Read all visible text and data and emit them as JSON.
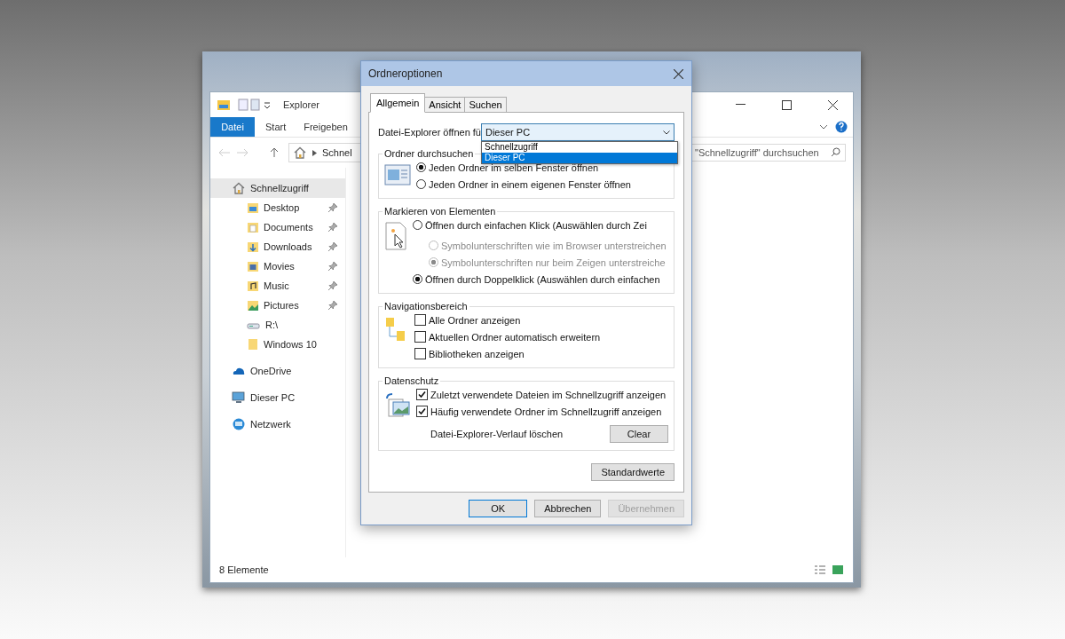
{
  "explorer": {
    "title": "Explorer",
    "ribbon_tabs": [
      {
        "label": "Datei",
        "selected": true
      },
      {
        "label": "Start",
        "selected": false
      },
      {
        "label": "Freigeben",
        "selected": false
      }
    ],
    "address": "Schnel",
    "search": {
      "placeholder": "\"Schnellzugriff\" durchsuchen"
    },
    "nav": [
      {
        "label": "Schnellzugriff",
        "kind": "home",
        "selected": true,
        "children": [
          {
            "label": "Desktop",
            "kind": "desktop",
            "pinned": true
          },
          {
            "label": "Documents",
            "kind": "documents",
            "pinned": true
          },
          {
            "label": "Downloads",
            "kind": "downloads",
            "pinned": true
          },
          {
            "label": "Movies",
            "kind": "movies",
            "pinned": true
          },
          {
            "label": "Music",
            "kind": "music",
            "pinned": true
          },
          {
            "label": "Pictures",
            "kind": "pictures",
            "pinned": true
          },
          {
            "label": "R:\\",
            "kind": "drive",
            "pinned": false
          },
          {
            "label": "Windows 10",
            "kind": "folder",
            "pinned": false
          }
        ]
      },
      {
        "label": "OneDrive",
        "kind": "cloud",
        "selected": false
      },
      {
        "label": "Dieser PC",
        "kind": "pc",
        "selected": false
      },
      {
        "label": "Netzwerk",
        "kind": "network",
        "selected": false
      }
    ],
    "status": "8 Elemente"
  },
  "dialog": {
    "title": "Ordneroptionen",
    "tabs": [
      {
        "label": "Allgemein",
        "selected": true
      },
      {
        "label": "Ansicht",
        "selected": false
      },
      {
        "label": "Suchen",
        "selected": false
      }
    ],
    "open_for": {
      "label": "Datei-Explorer öffnen fü",
      "value": "Dieser PC",
      "options": [
        {
          "label": "Schnellzugriff",
          "selected": false
        },
        {
          "label": "Dieser PC",
          "selected": true
        }
      ]
    },
    "groups": [
      {
        "title": "Ordner durchsuchen",
        "kind": "browse",
        "options": [
          {
            "kind": "radio",
            "label": "Jeden Ordner im selben Fenster öffnen",
            "selected": true,
            "disabled": false
          },
          {
            "kind": "radio",
            "label": "Jeden Ordner in einem eigenen Fenster öffnen",
            "selected": false,
            "disabled": false
          }
        ]
      },
      {
        "title": "Markieren von Elementen",
        "kind": "click",
        "options": [
          {
            "kind": "radio",
            "label": "Öffnen durch einfachen Klick (Auswählen durch Zei",
            "selected": false,
            "disabled": false,
            "children": [
              {
                "kind": "radio",
                "label": "Symbolunterschriften wie im Browser unterstreichen",
                "selected": false,
                "disabled": true
              },
              {
                "kind": "radio",
                "label": "Symbolunterschriften nur beim Zeigen unterstreiche",
                "selected": true,
                "disabled": true
              }
            ]
          },
          {
            "kind": "radio",
            "label": "Öffnen durch Doppelklick (Auswählen durch einfachen",
            "selected": true,
            "disabled": false
          }
        ]
      },
      {
        "title": "Navigationsbereich",
        "kind": "tree",
        "options": [
          {
            "kind": "checkbox",
            "label": "Alle Ordner anzeigen",
            "checked": false
          },
          {
            "kind": "checkbox",
            "label": "Aktuellen Ordner automatisch erweitern",
            "checked": false
          },
          {
            "kind": "checkbox",
            "label": "Bibliotheken anzeigen",
            "checked": false
          }
        ]
      },
      {
        "title": "Datenschutz",
        "kind": "privacy",
        "options": [
          {
            "kind": "checkbox",
            "label": "Zuletzt verwendete Dateien im Schnellzugriff anzeigen",
            "checked": true
          },
          {
            "kind": "checkbox",
            "label": "Häufig verwendete Ordner im Schnellzugriff anzeigen",
            "checked": true
          },
          {
            "kind": "action",
            "label": "Datei-Explorer-Verlauf löschen",
            "button": "Clear"
          }
        ]
      }
    ],
    "defaults_button": "Standardwerte",
    "buttons": [
      {
        "label": "OK",
        "default": true,
        "disabled": false
      },
      {
        "label": "Abbrechen",
        "default": false,
        "disabled": false
      },
      {
        "label": "Übernehmen",
        "default": false,
        "disabled": true
      }
    ]
  }
}
